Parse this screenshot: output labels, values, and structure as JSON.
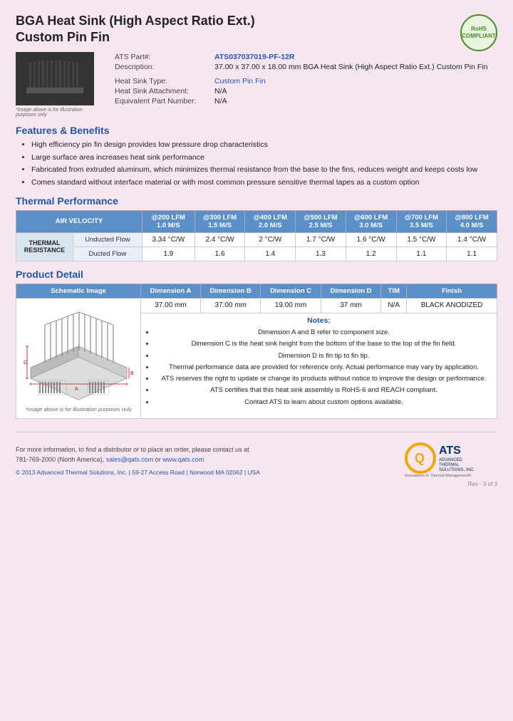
{
  "title_line1": "BGA Heat Sink (High Aspect Ratio Ext.)",
  "title_line2": "Custom Pin Fin",
  "ats_part_label": "ATS Part#:",
  "ats_part_number": "ATS037037019-PF-12R",
  "description_label": "Description:",
  "description_value": "37.00 x 37.00 x 18.00 mm  BGA Heat Sink (High Aspect Ratio Ext.) Custom Pin Fin",
  "heat_sink_type_label": "Heat Sink Type:",
  "heat_sink_type_value": "Custom Pin Fin",
  "heat_sink_attachment_label": "Heat Sink Attachment:",
  "heat_sink_attachment_value": "N/A",
  "equivalent_part_label": "Equivalent Part Number:",
  "equivalent_part_value": "N/A",
  "image_caption": "*Image above is for illustration purposes only",
  "features_title": "Features & Benefits",
  "features": [
    "High efficiency pin fin design provides low pressure drop characteristics",
    "Large surface area increases heat sink performance",
    "Fabricated from extruded aluminum, which minimizes thermal resistance from the base to the fins, reduces weight and keeps costs low",
    "Comes standard without interface material or with most common pressure sensitive thermal tapes as a custom option"
  ],
  "thermal_title": "Thermal Performance",
  "thermal_table": {
    "col_header": "AIR VELOCITY",
    "columns": [
      {
        "lfm": "@200 LFM",
        "ms": "1.0 M/S"
      },
      {
        "lfm": "@300 LFM",
        "ms": "1.5 M/S"
      },
      {
        "lfm": "@400 LFM",
        "ms": "2.0 M/S"
      },
      {
        "lfm": "@500 LFM",
        "ms": "2.5 M/S"
      },
      {
        "lfm": "@600 LFM",
        "ms": "3.0 M/S"
      },
      {
        "lfm": "@700 LFM",
        "ms": "3.5 M/S"
      },
      {
        "lfm": "@800 LFM",
        "ms": "4.0 M/S"
      }
    ],
    "row_label": "THERMAL RESISTANCE",
    "rows": [
      {
        "type": "Unducted Flow",
        "values": [
          "3.34 °C/W",
          "2.4 °C/W",
          "2 °C/W",
          "1.7 °C/W",
          "1.6 °C/W",
          "1.5 °C/W",
          "1.4 °C/W"
        ]
      },
      {
        "type": "Ducted Flow",
        "values": [
          "1.9",
          "1.6",
          "1.4",
          "1.3",
          "1.2",
          "1.1",
          "1.1"
        ]
      }
    ]
  },
  "product_detail_title": "Product Detail",
  "product_detail_table": {
    "columns": [
      "Schematic Image",
      "Dimension A",
      "Dimension B",
      "Dimension C",
      "Dimension D",
      "TIM",
      "Finish"
    ],
    "values": [
      "37.00 mm",
      "37.00 mm",
      "19.00 mm",
      "37 mm",
      "N/A",
      "BLACK ANODIZED"
    ]
  },
  "notes_title": "Notes:",
  "notes": [
    "Dimension A and B refer to component size.",
    "Dimension C is the heat sink height from the bottom of the base to the top of the fin field.",
    "Dimension D is fin tip to fin tip.",
    "Thermal performance data are provided for reference only. Actual performance may vary by application.",
    "ATS reserves the right to update or change its products without notice to improve the design or performance.",
    "ATS certifies that this heat sink assembly is RoHS-6 and REACH compliant.",
    "Contact ATS to learn about custom options available."
  ],
  "schematic_caption": "*Image above is for illustration purposes only",
  "footer": {
    "contact_text": "For more information, to find a distributor or to place an order, please contact us at",
    "phone": "781-769-2000 (North America)",
    "email": "sales@qats.com",
    "or": "or",
    "website": "www.qats.com",
    "copyright": "© 2013 Advanced Thermal Solutions, Inc.  |  59-27 Access Road  |  Norwood MA  02062  |  USA",
    "page_num": "Rev - 3 of 3"
  },
  "ats_logo": {
    "q_letter": "Q",
    "company_name": "ATS",
    "full_name": "ADVANCED\nTHERMAL\nSOLUTIONS, INC.",
    "tagline": "Innovations in Thermal Management®"
  },
  "rohs_text": "RoHS\nCOMPLIANT"
}
